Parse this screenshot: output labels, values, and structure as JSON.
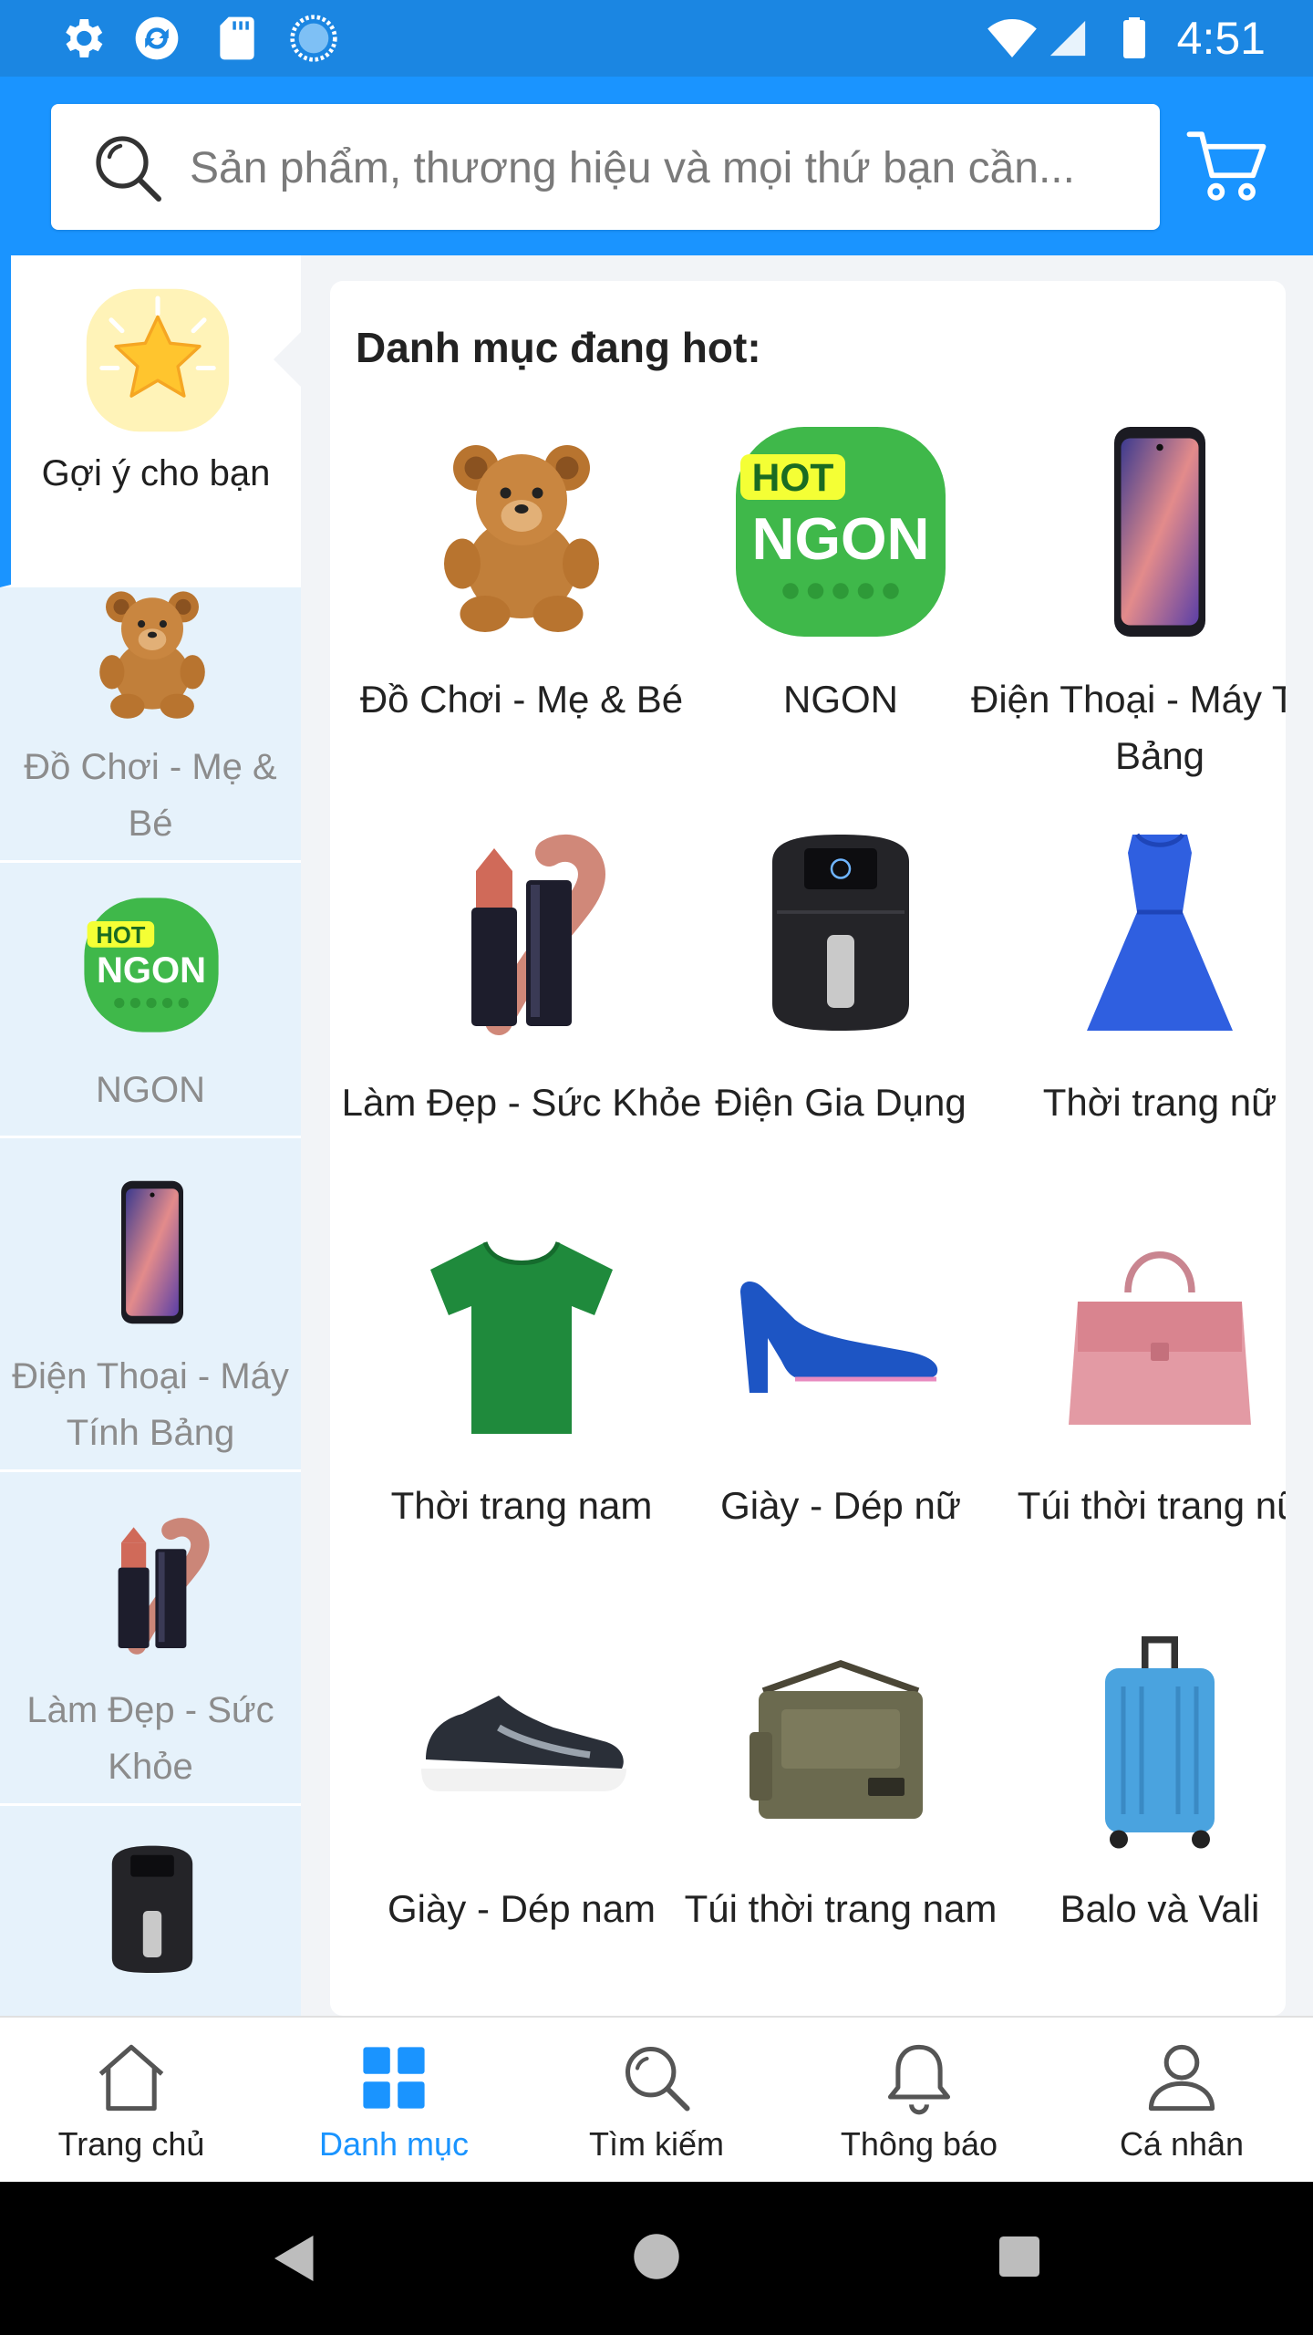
{
  "status_bar": {
    "time": "4:51"
  },
  "search": {
    "placeholder": "Sản phẩm, thương hiệu và mọi thứ bạn cần..."
  },
  "sidebar": {
    "items": [
      {
        "label": "Gợi ý cho bạn",
        "icon": "star-icon",
        "active": true
      },
      {
        "label": "Đồ Chơi - Mẹ & Bé",
        "icon": "teddy-bear-icon"
      },
      {
        "label": "NGON",
        "icon": "hot-ngon-icon"
      },
      {
        "label": "Điện Thoại - Máy Tính Bảng",
        "icon": "smartphone-icon"
      },
      {
        "label": "Làm Đẹp - Sức Khỏe",
        "icon": "lipstick-icon"
      },
      {
        "label": "",
        "icon": "air-fryer-icon"
      }
    ]
  },
  "content": {
    "title": "Danh mục đang hot:",
    "hot_ngon": {
      "badge": "HOT",
      "word": "NGON"
    },
    "categories": [
      {
        "label": "Đồ Chơi - Mẹ & Bé",
        "icon": "teddy-bear-icon"
      },
      {
        "label": "NGON",
        "icon": "hot-ngon-icon"
      },
      {
        "label": "Điện Thoại - Máy Tính Bảng",
        "icon": "smartphone-icon"
      },
      {
        "label": "Làm Đẹp - Sức Khỏe",
        "icon": "lipstick-icon"
      },
      {
        "label": "Điện Gia Dụng",
        "icon": "air-fryer-icon"
      },
      {
        "label": "Thời trang nữ",
        "icon": "dress-icon"
      },
      {
        "label": "Thời trang nam",
        "icon": "tshirt-icon"
      },
      {
        "label": "Giày - Dép nữ",
        "icon": "heel-shoe-icon"
      },
      {
        "label": "Túi thời trang nữ",
        "icon": "handbag-icon"
      },
      {
        "label": "Giày - Dép nam",
        "icon": "sneaker-icon"
      },
      {
        "label": "Túi thời trang nam",
        "icon": "messenger-bag-icon"
      },
      {
        "label": "Balo và Vali",
        "icon": "suitcase-icon"
      }
    ]
  },
  "bottom_nav": {
    "items": [
      {
        "label": "Trang chủ",
        "icon": "home-icon"
      },
      {
        "label": "Danh mục",
        "icon": "category-grid-icon",
        "active": true
      },
      {
        "label": "Tìm kiếm",
        "icon": "search-icon"
      },
      {
        "label": "Thông báo",
        "icon": "bell-icon"
      },
      {
        "label": "Cá nhân",
        "icon": "user-icon"
      }
    ]
  },
  "colors": {
    "brand": "#1a94ff",
    "status_bar": "#1b86e2",
    "sidebar_bg": "#e6f2fb",
    "active_nav": "#1a94ff"
  }
}
